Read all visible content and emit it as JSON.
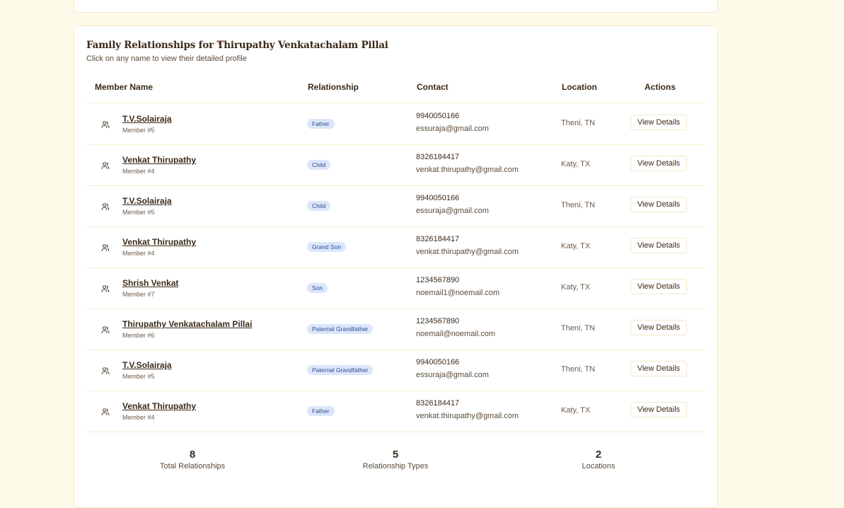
{
  "panel": {
    "title": "Family Relationships for Thirupathy Venkatachalam Pillai",
    "subtitle": "Click on any name to view their detailed profile"
  },
  "table": {
    "headers": [
      "Member Name",
      "Relationship",
      "Contact",
      "Location",
      "Actions"
    ],
    "rows": [
      {
        "name": "T.V.Solairaja",
        "member": "Member #5",
        "relationship": "Father",
        "phone": "9940050166",
        "email": "essuraja@gmail.com",
        "location": "Theni, TN",
        "action": "View Details"
      },
      {
        "name": "Venkat Thirupathy",
        "member": "Member #4",
        "relationship": "Child",
        "phone": "8326184417",
        "email": "venkat.thirupathy@gmail.com",
        "location": "Katy, TX",
        "action": "View Details"
      },
      {
        "name": "T.V.Solairaja",
        "member": "Member #5",
        "relationship": "Child",
        "phone": "9940050166",
        "email": "essuraja@gmail.com",
        "location": "Theni, TN",
        "action": "View Details"
      },
      {
        "name": "Venkat Thirupathy",
        "member": "Member #4",
        "relationship": "Grand Son",
        "phone": "8326184417",
        "email": "venkat.thirupathy@gmail.com",
        "location": "Katy, TX",
        "action": "View Details"
      },
      {
        "name": "Shrish Venkat",
        "member": "Member #7",
        "relationship": "Son",
        "phone": "1234567890",
        "email": "noemail1@noemail.com",
        "location": "Katy, TX",
        "action": "View Details"
      },
      {
        "name": "Thirupathy Venkatachalam Pillai",
        "member": "Member #6",
        "relationship": "Paternal Grandfather",
        "phone": "1234567890",
        "email": "noemail@noemail.com",
        "location": "Theni, TN",
        "action": "View Details"
      },
      {
        "name": "T.V.Solairaja",
        "member": "Member #5",
        "relationship": "Paternal Grandfather",
        "phone": "9940050166",
        "email": "essuraja@gmail.com",
        "location": "Theni, TN",
        "action": "View Details"
      },
      {
        "name": "Venkat Thirupathy",
        "member": "Member #4",
        "relationship": "Father",
        "phone": "8326184417",
        "email": "venkat.thirupathy@gmail.com",
        "location": "Katy, TX",
        "action": "View Details"
      }
    ]
  },
  "stats": [
    {
      "value": "8",
      "label": "Total Relationships"
    },
    {
      "value": "5",
      "label": "Relationship Types"
    },
    {
      "value": "2",
      "label": "Locations"
    }
  ],
  "icons": {
    "row_icon": "users-icon"
  },
  "colors": {
    "background": "#fefbea",
    "badge_bg": "#dbe6fb",
    "badge_text": "#2f4d8f",
    "text": "#3b2a1a"
  }
}
